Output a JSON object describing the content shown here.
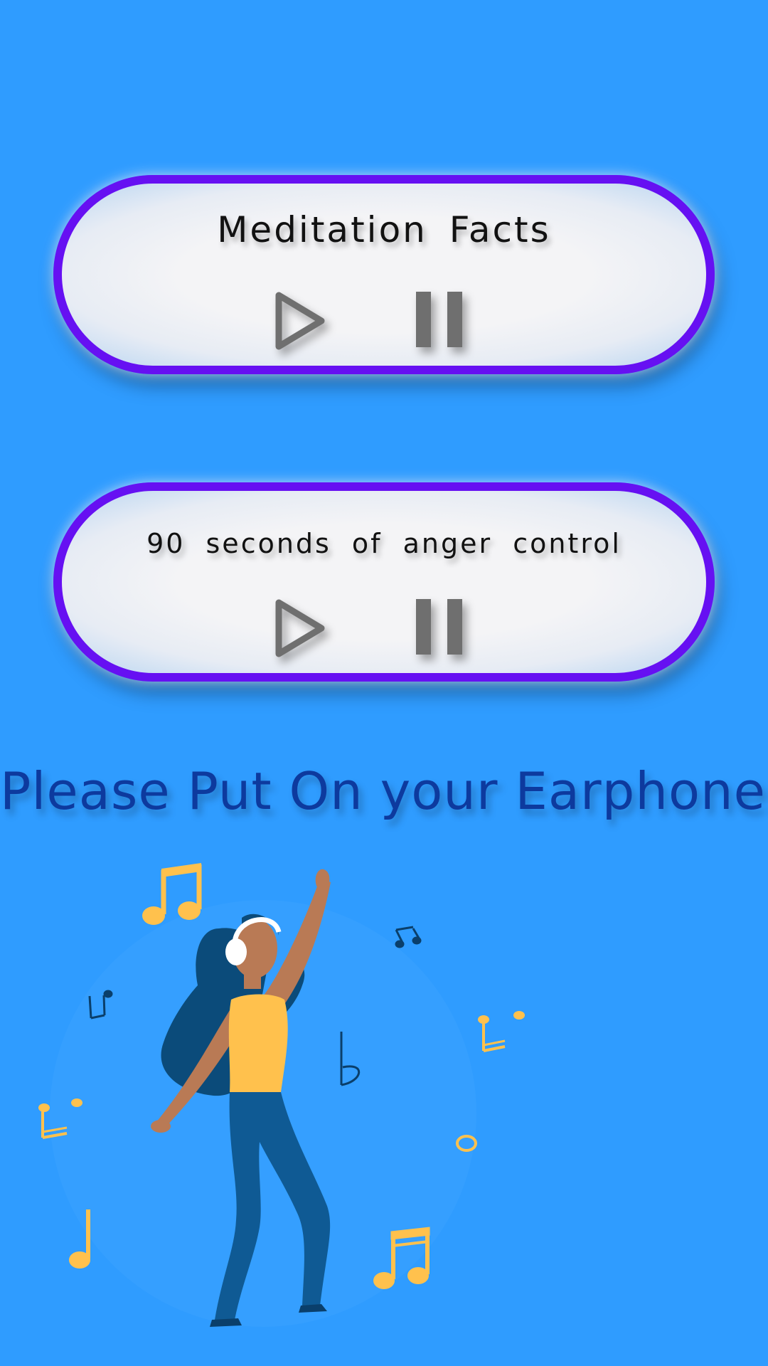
{
  "cards": [
    {
      "title": "Meditation  Facts",
      "play_icon": "play-icon",
      "pause_icon": "pause-icon"
    },
    {
      "title": "90  seconds  of  anger  control",
      "play_icon": "play-icon",
      "pause_icon": "pause-icon"
    }
  ],
  "prompt": "Please Put On your Earphones",
  "illustration": "woman-dancing-with-headphones-illustration",
  "colors": {
    "background": "#2f9cff",
    "card_border": "#6610f2",
    "card_fill": "#f4f4f6",
    "icon": "#6f6f6f",
    "prompt_text": "#0d3a9e",
    "note_yellow": "#ffc14d",
    "note_dark": "#0a3f6b"
  }
}
